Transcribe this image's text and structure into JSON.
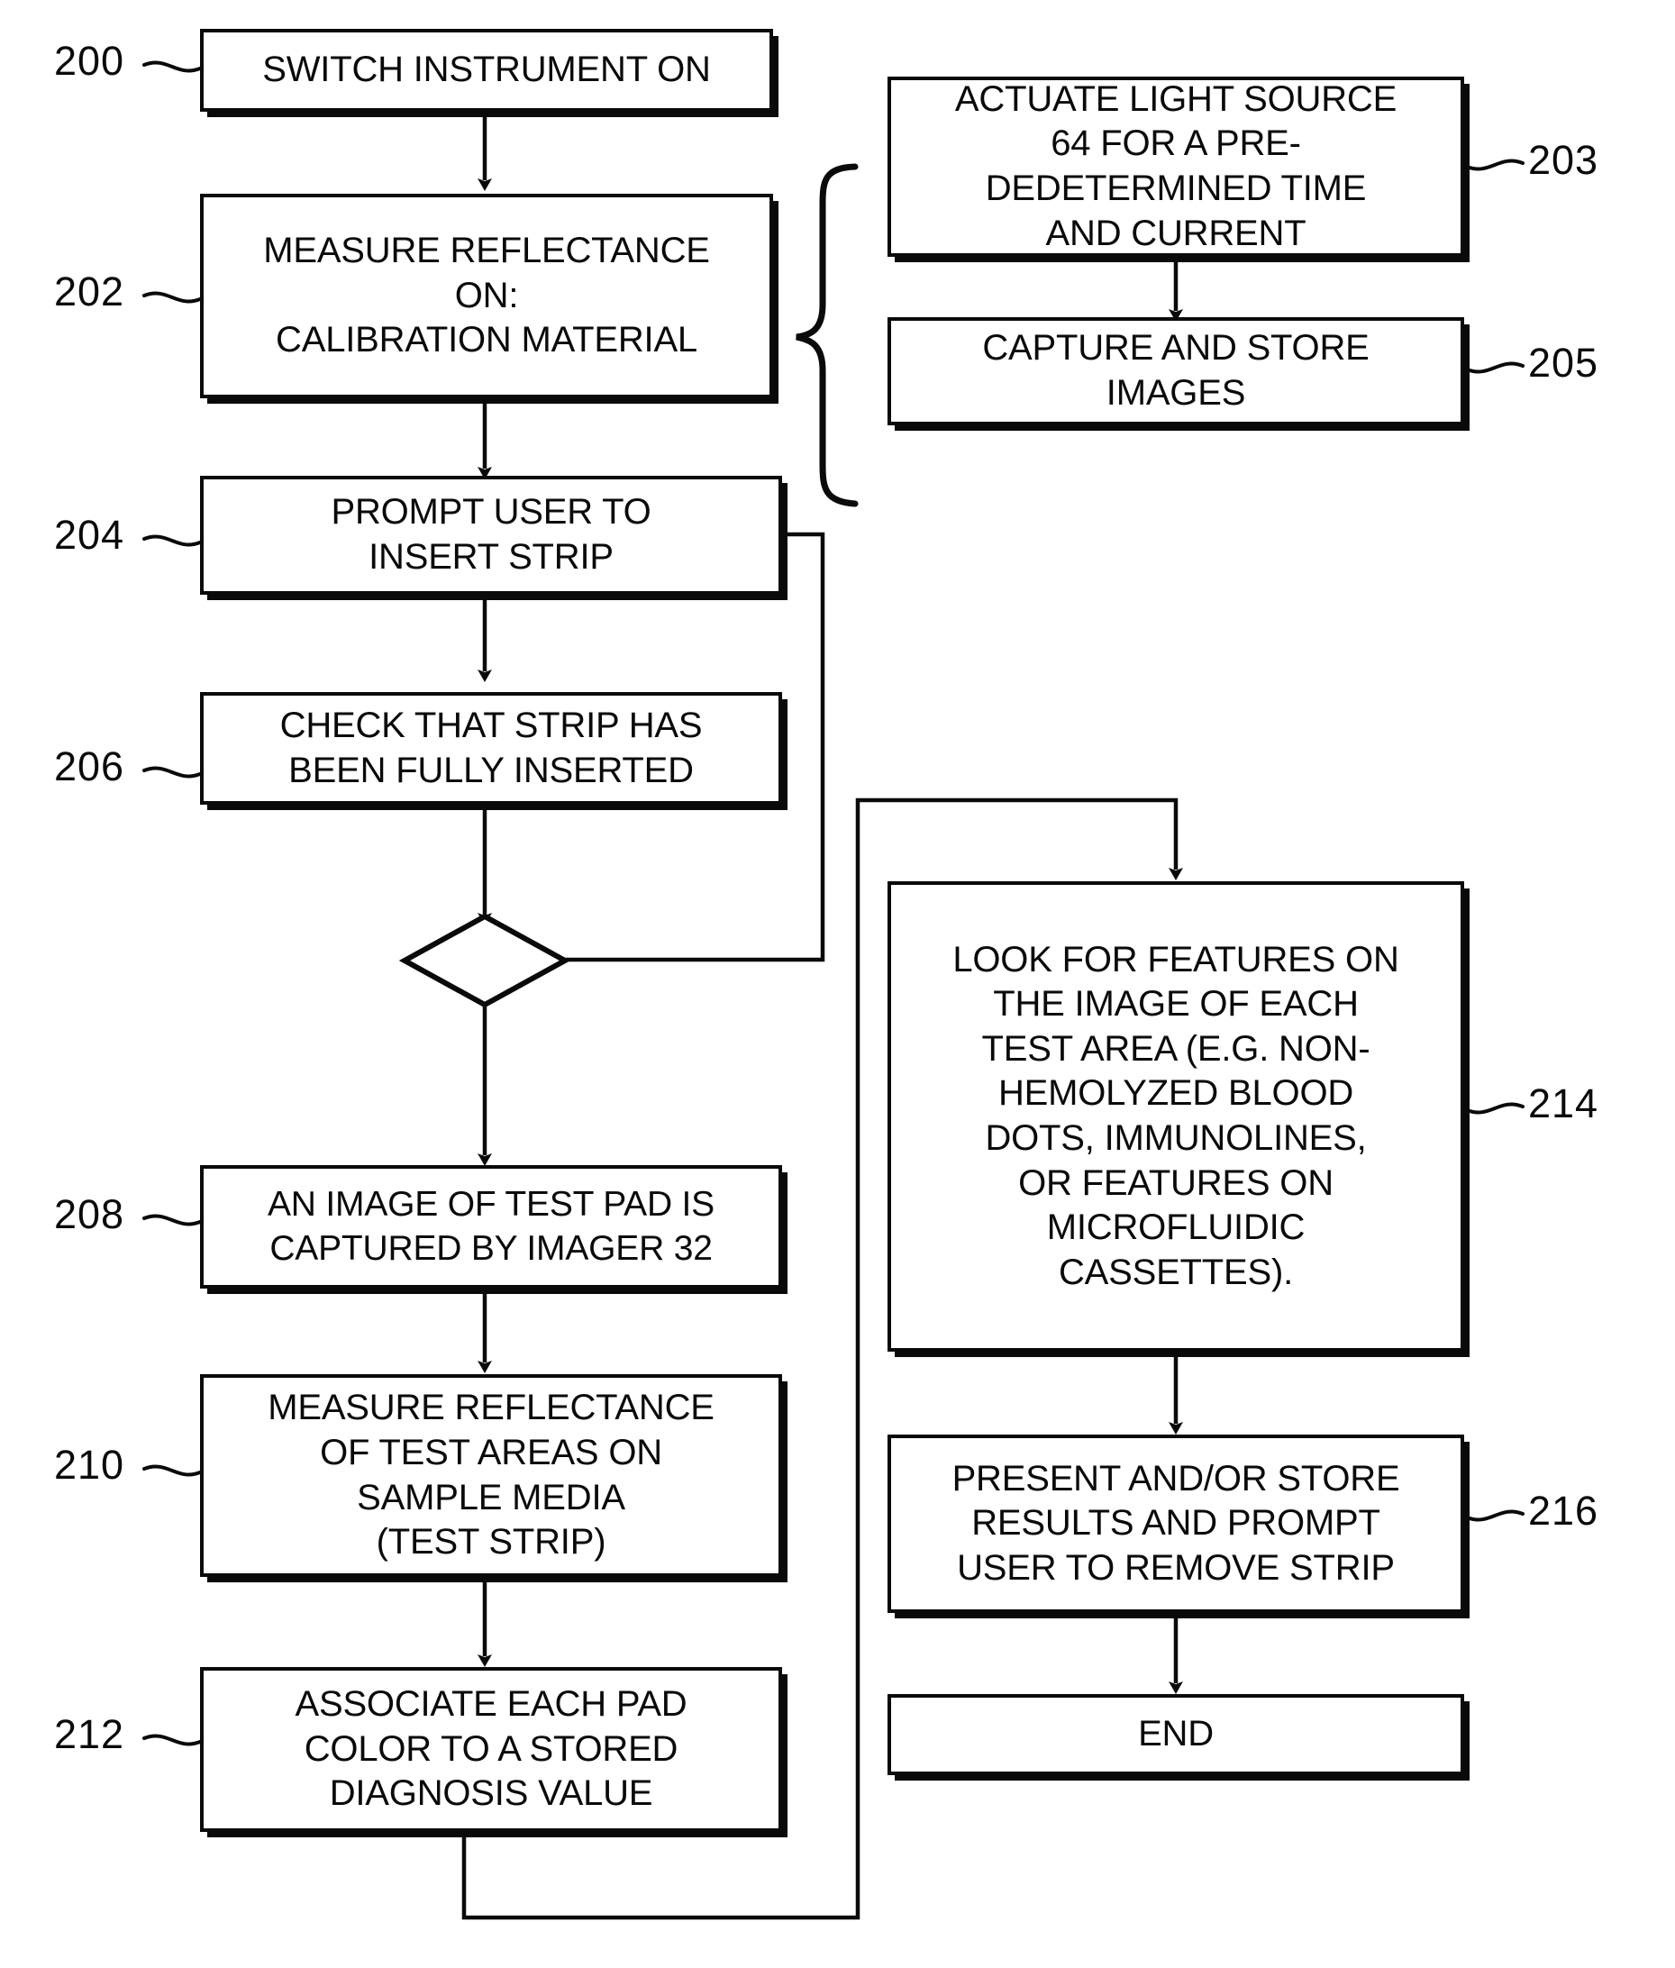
{
  "figure": {
    "type": "patent-flowchart",
    "title": "Instrument measurement and diagnosis process flowchart"
  },
  "nodes": [
    {
      "id": "n200",
      "ref": "200",
      "shape": "process",
      "text": "SWITCH INSTRUMENT ON"
    },
    {
      "id": "n202",
      "ref": "202",
      "shape": "process",
      "text": "MEASURE REFLECTANCE\nON:\nCALIBRATION MATERIAL"
    },
    {
      "id": "n203",
      "ref": "203",
      "shape": "process",
      "text": "ACTUATE LIGHT SOURCE\n64 FOR A PRE-\nDEDETERMINED TIME\nAND CURRENT"
    },
    {
      "id": "n205",
      "ref": "205",
      "shape": "process",
      "text": "CAPTURE AND STORE\nIMAGES"
    },
    {
      "id": "n204",
      "ref": "204",
      "shape": "process",
      "text": "PROMPT USER TO\nINSERT STRIP"
    },
    {
      "id": "n206",
      "ref": "206",
      "shape": "process",
      "text": "CHECK THAT STRIP HAS\nBEEN FULLY INSERTED"
    },
    {
      "id": "ndec",
      "ref": "",
      "shape": "decision",
      "text": ""
    },
    {
      "id": "n208",
      "ref": "208",
      "shape": "process",
      "text": "AN IMAGE OF TEST PAD IS\nCAPTURED BY IMAGER 32"
    },
    {
      "id": "n210",
      "ref": "210",
      "shape": "process",
      "text": "MEASURE REFLECTANCE\nOF TEST AREAS ON\nSAMPLE MEDIA\n(TEST STRIP)"
    },
    {
      "id": "n212",
      "ref": "212",
      "shape": "process",
      "text": "ASSOCIATE EACH PAD\nCOLOR TO A STORED\nDIAGNOSIS VALUE"
    },
    {
      "id": "n214",
      "ref": "214",
      "shape": "process",
      "text": "LOOK FOR FEATURES ON\nTHE IMAGE OF EACH\nTEST AREA (E.G. NON-\nHEMOLYZED BLOOD\nDOTS, IMMUNOLINES,\nOR FEATURES ON\nMICROFLUIDIC\nCASSETTES)."
    },
    {
      "id": "n216",
      "ref": "216",
      "shape": "process",
      "text": "PRESENT AND/OR STORE\nRESULTS AND PROMPT\nUSER TO REMOVE STRIP"
    },
    {
      "id": "nend",
      "ref": "",
      "shape": "terminator",
      "text": "END"
    }
  ],
  "labels": {
    "n200": "SWITCH INSTRUMENT ON",
    "n202": "MEASURE REFLECTANCE\nON:\nCALIBRATION MATERIAL",
    "n203": "ACTUATE LIGHT SOURCE\n64 FOR A PRE-\nDEDETERMINED TIME\nAND CURRENT",
    "n205": "CAPTURE AND STORE\nIMAGES",
    "n204": "PROMPT USER TO\nINSERT STRIP",
    "n206": "CHECK THAT STRIP HAS\nBEEN FULLY INSERTED",
    "ndec": "",
    "n208": "AN IMAGE OF TEST PAD IS\nCAPTURED BY IMAGER 32",
    "n210": "MEASURE REFLECTANCE\nOF TEST AREAS ON\nSAMPLE MEDIA\n(TEST STRIP)",
    "n212": "ASSOCIATE EACH PAD\nCOLOR TO A STORED\nDIAGNOSIS VALUE",
    "n214": "LOOK FOR FEATURES ON\nTHE IMAGE OF EACH\nTEST AREA (E.G. NON-\nHEMOLYZED BLOOD\nDOTS, IMMUNOLINES,\nOR FEATURES ON\nMICROFLUIDIC\nCASSETTES).",
    "n216": "PRESENT AND/OR STORE\nRESULTS AND PROMPT\nUSER TO REMOVE STRIP",
    "nend": "END"
  },
  "refs": {
    "r200": "200",
    "r202": "202",
    "r203": "203",
    "r204": "204",
    "r205": "205",
    "r206": "206",
    "r208": "208",
    "r210": "210",
    "r212": "212",
    "r214": "214",
    "r216": "216"
  },
  "colors": {
    "ink": "#0a0a0a",
    "paper": "#ffffff"
  }
}
